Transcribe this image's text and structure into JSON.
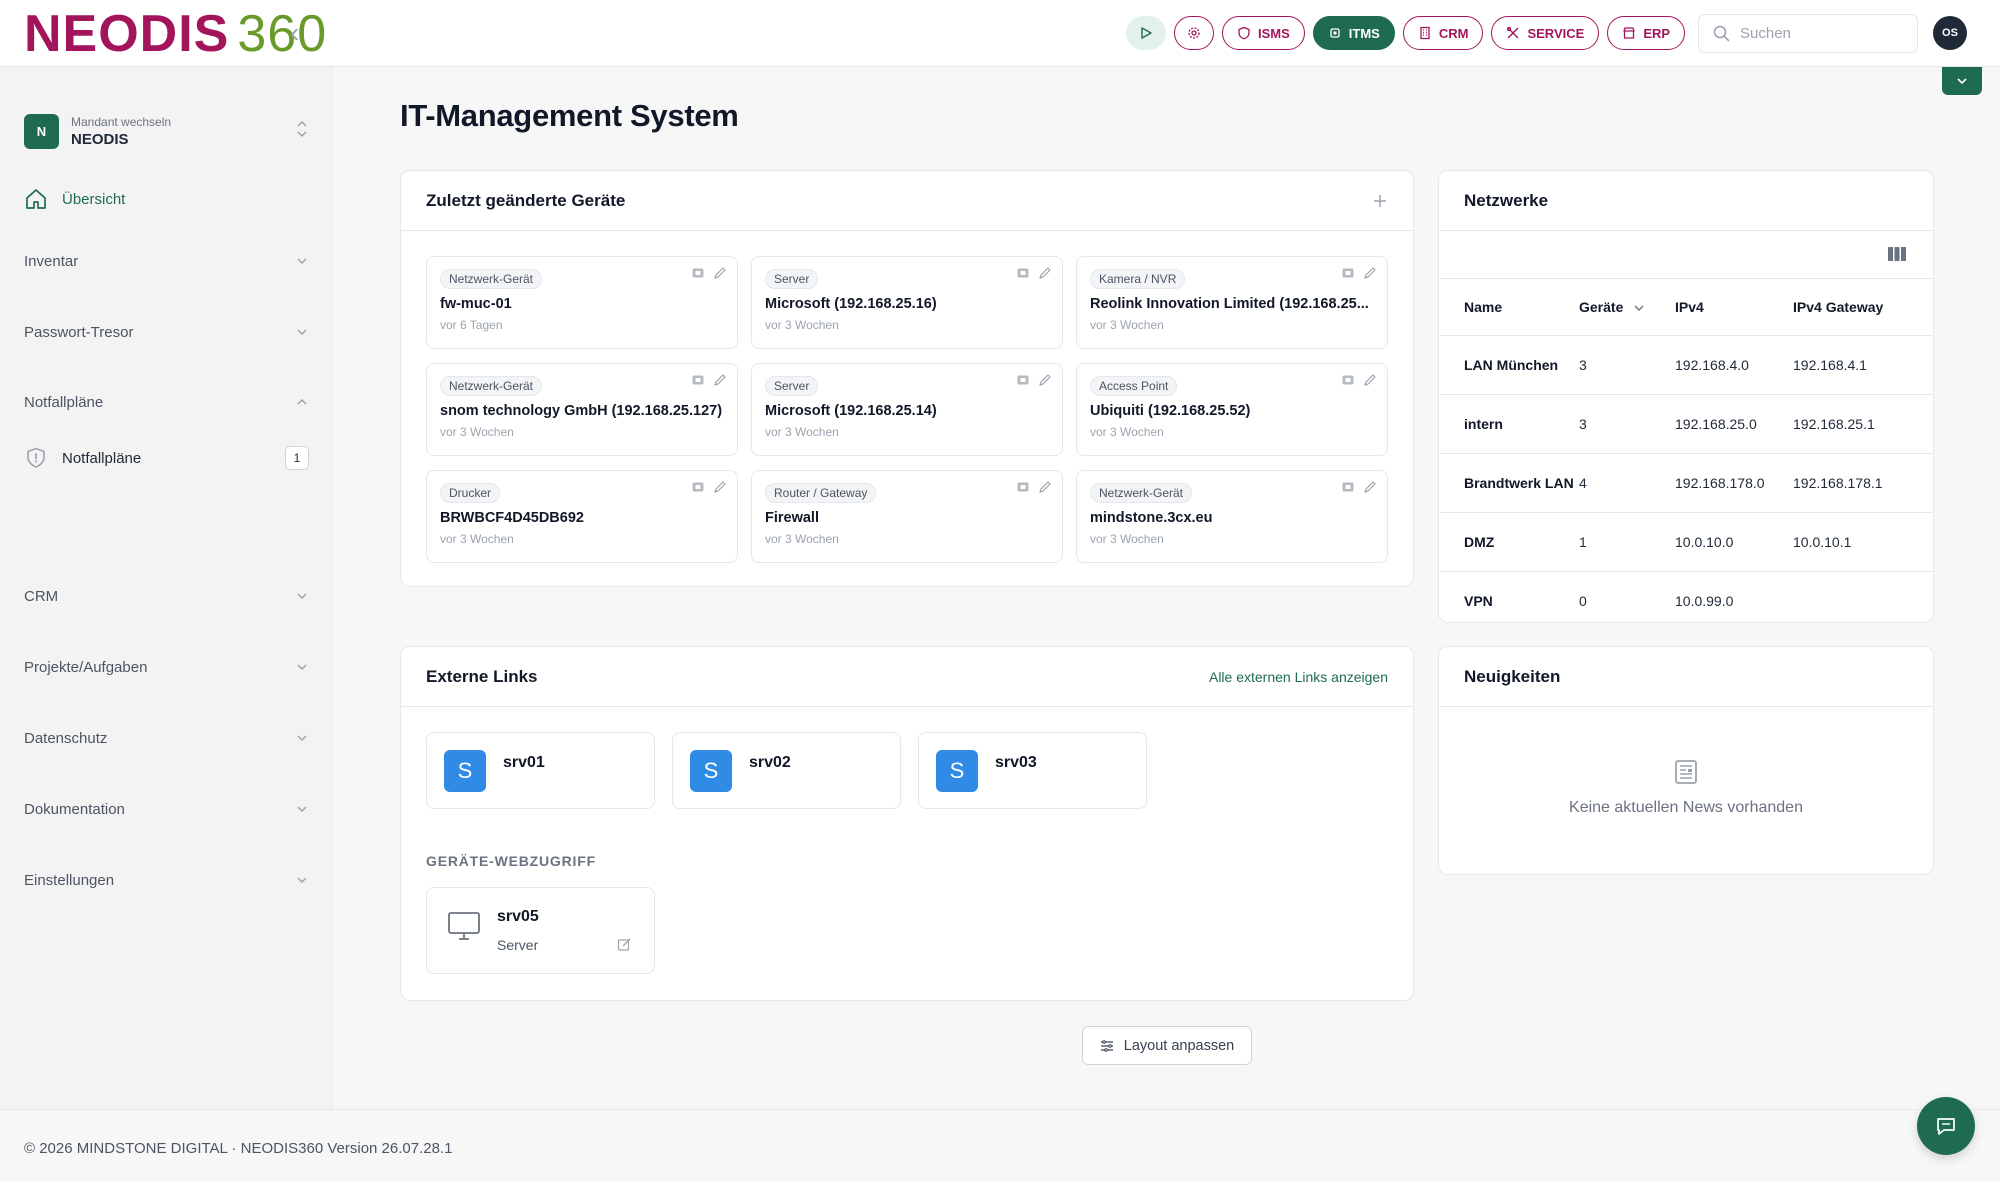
{
  "brand": {
    "logo_part1": "NEODIS",
    "logo_part2": "360",
    "primary_color": "#1e6b50",
    "accent_color": "#a3155b"
  },
  "header": {
    "pills": [
      {
        "label": "ISMS"
      },
      {
        "label": "ITMS"
      },
      {
        "label": "CRM"
      },
      {
        "label": "SERVICE"
      },
      {
        "label": "ERP"
      }
    ],
    "active_pill": "ITMS",
    "search": {
      "placeholder": "Suchen",
      "value": ""
    },
    "user_initials": "OS"
  },
  "sidebar": {
    "tenant": {
      "badge": "N",
      "sub": "Mandant wechseln",
      "name": "NEODIS"
    },
    "home": "Übersicht",
    "sections": [
      "Inventar",
      "Passwort-Tresor",
      "Notfallpläne",
      "CRM",
      "Projekte/Aufgaben",
      "Datenschutz",
      "Dokumentation",
      "Einstellungen"
    ],
    "sub_item": {
      "label": "Notfallpläne",
      "count": "1"
    }
  },
  "main": {
    "title": "IT-Management System",
    "devices": {
      "title": "Zuletzt geänderte Geräte",
      "items": [
        {
          "type": "Netzwerk-Gerät",
          "name": "fw-muc-01",
          "time": "vor 6 Tagen"
        },
        {
          "type": "Server",
          "name": "Microsoft (192.168.25.16)",
          "time": "vor 3 Wochen"
        },
        {
          "type": "Kamera / NVR",
          "name": "Reolink Innovation Limited (192.168.25...",
          "time": "vor 3 Wochen"
        },
        {
          "type": "Netzwerk-Gerät",
          "name": "snom technology GmbH (192.168.25.127)",
          "time": "vor 3 Wochen"
        },
        {
          "type": "Server",
          "name": "Microsoft (192.168.25.14)",
          "time": "vor 3 Wochen"
        },
        {
          "type": "Access Point",
          "name": "Ubiquiti (192.168.25.52)",
          "time": "vor 3 Wochen"
        },
        {
          "type": "Drucker",
          "name": "BRWBCF4D45DB692",
          "time": "vor 3 Wochen"
        },
        {
          "type": "Router / Gateway",
          "name": "Firewall",
          "time": "vor 3 Wochen"
        },
        {
          "type": "Netzwerk-Gerät",
          "name": "mindstone.3cx.eu",
          "time": "vor 3 Wochen"
        }
      ]
    },
    "networks": {
      "title": "Netzwerke",
      "columns": [
        "Name",
        "Geräte",
        "IPv4",
        "IPv4 Gateway"
      ],
      "rows": [
        [
          "LAN München",
          "3",
          "192.168.4.0",
          "192.168.4.1"
        ],
        [
          "intern",
          "3",
          "192.168.25.0",
          "192.168.25.1"
        ],
        [
          "Brandtwerk LAN",
          "4",
          "192.168.178.0",
          "192.168.178.1"
        ],
        [
          "DMZ",
          "1",
          "10.0.10.0",
          "10.0.10.1"
        ],
        [
          "VPN",
          "0",
          "10.0.99.0",
          ""
        ]
      ]
    },
    "links": {
      "title": "Externe Links",
      "show_all": "Alle externen Links anzeigen",
      "items": [
        {
          "badge": "S",
          "name": "srv01"
        },
        {
          "badge": "S",
          "name": "srv02"
        },
        {
          "badge": "S",
          "name": "srv03"
        }
      ],
      "web_heading": "GERÄTE-WEBZUGRIFF",
      "web_item": {
        "name": "srv05",
        "type": "Server"
      }
    },
    "news": {
      "title": "Neuigkeiten",
      "empty": "Keine aktuellen News vorhanden"
    },
    "layout_button": "Layout anpassen"
  },
  "footer": {
    "text": "© 2026 MINDSTONE DIGITAL · NEODIS360 Version 26.07.28.1"
  }
}
